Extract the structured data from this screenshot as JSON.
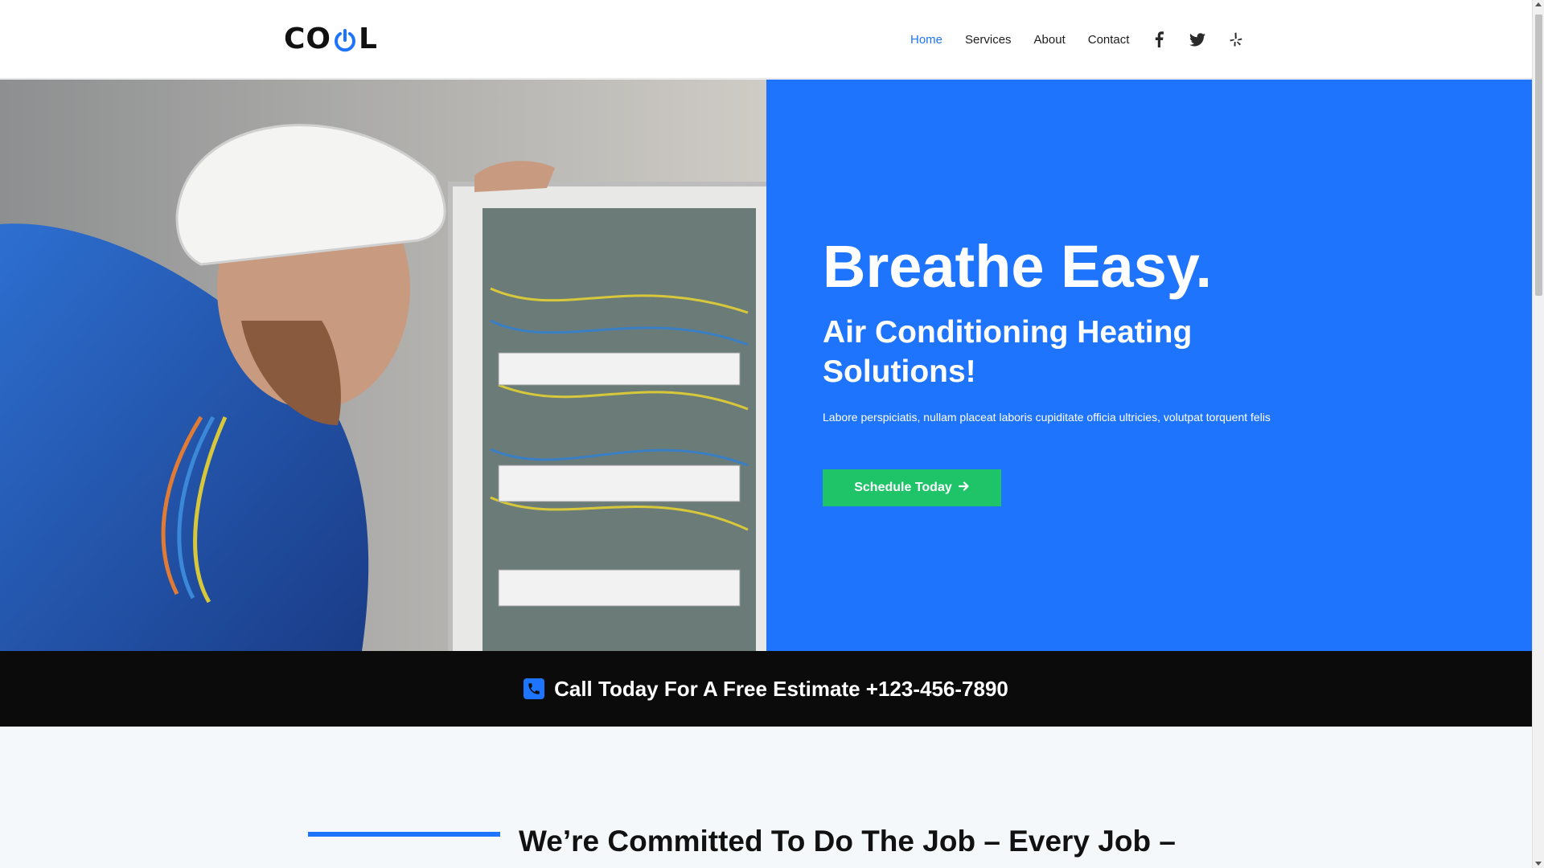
{
  "header": {
    "logo_text_left": "CO",
    "logo_text_right": "L",
    "nav": [
      {
        "label": "Home",
        "active": true
      },
      {
        "label": "Services",
        "active": false
      },
      {
        "label": "About",
        "active": false
      },
      {
        "label": "Contact",
        "active": false
      }
    ],
    "social_icons": [
      "facebook-icon",
      "twitter-icon",
      "yelp-icon"
    ]
  },
  "hero": {
    "title": "Breathe Easy.",
    "subtitle": "Air Conditioning Heating Solutions!",
    "text": "Labore perspiciatis, nullam placeat laboris cupiditate officia ultricies, volutpat torquent felis",
    "cta_label": "Schedule Today",
    "cta_icon": "arrow-right-icon",
    "image_icon": "electrician-photo"
  },
  "callbar": {
    "text": "Call Today For A Free Estimate +123-456-7890",
    "icon": "phone-icon"
  },
  "committed": {
    "title": "We’re Committed To Do The Job – Every Job –"
  },
  "colors": {
    "accent": "#1e74fd",
    "cta": "#1ec467",
    "dark": "#0b0b0b"
  }
}
